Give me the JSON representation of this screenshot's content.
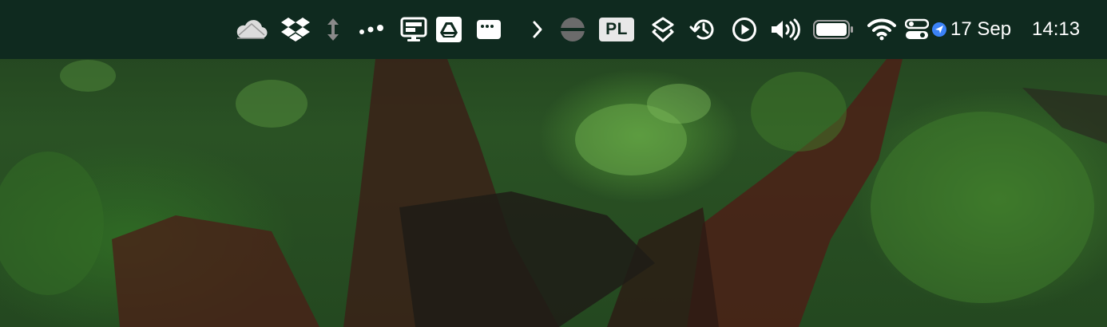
{
  "menubar": {
    "status_items": [
      {
        "name": "cloud-icon"
      },
      {
        "name": "dropbox-icon"
      },
      {
        "name": "resize-arrows-icon"
      },
      {
        "name": "dots-icon"
      },
      {
        "name": "monitor-icon"
      },
      {
        "name": "drive-icon"
      },
      {
        "name": "window-icon"
      },
      {
        "name": "chevron-right-icon"
      },
      {
        "name": "vpn-icon"
      },
      {
        "name": "layers-icon"
      },
      {
        "name": "time-machine-icon"
      },
      {
        "name": "play-icon"
      },
      {
        "name": "volume-icon"
      },
      {
        "name": "battery-icon"
      },
      {
        "name": "wifi-icon"
      },
      {
        "name": "control-center-icon"
      },
      {
        "name": "location-icon"
      }
    ],
    "input_source": "PL",
    "date": "17 Sep",
    "time": "14:13",
    "colors": {
      "bar": "#0f2a1f",
      "icon": "#ffffff",
      "location_badge": "#3b82f6"
    }
  }
}
